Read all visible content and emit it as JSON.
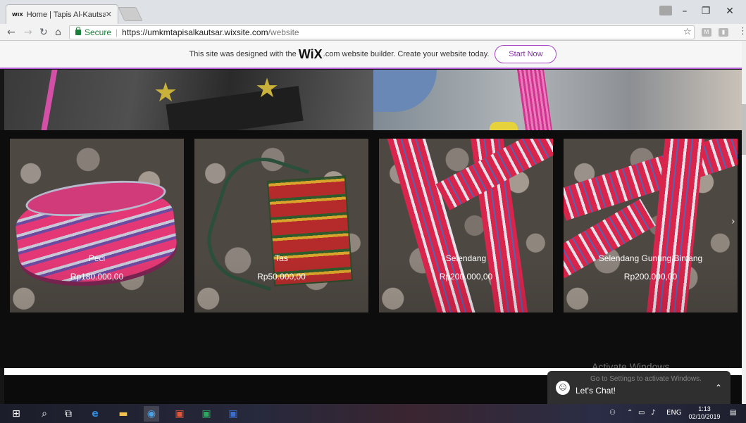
{
  "browser": {
    "tab_title": "Home | Tapis Al-Kautsar",
    "tab_favicon": "WIX",
    "secure_label": "Secure",
    "url_host": "https://umkmtapisalkautsar.wixsite.com",
    "url_path": "/website"
  },
  "wix_banner": {
    "text_before": "This site was designed with the",
    "logo": "WiX",
    "text_after": ".com website builder. Create your website today.",
    "button_label": "Start Now"
  },
  "products": [
    {
      "name": "Peci",
      "price": "Rp180.000,00"
    },
    {
      "name": "Tas",
      "price": "Rp50.000,00"
    },
    {
      "name": "Selendang",
      "price": "Rp200.000,00"
    },
    {
      "name": "Selendang Gunung Bintang",
      "price": "Rp200.000,00"
    }
  ],
  "watermark": {
    "title": "Activate Windows",
    "subtitle": "Go to Settings to activate Windows."
  },
  "chat": {
    "label": "Let's Chat!"
  },
  "taskbar": {
    "language": "ENG",
    "time": "1:13",
    "date": "02/10/2019"
  },
  "colors": {
    "wix_accent": "#a845c4",
    "secure_green": "#188038",
    "page_bg": "#0d0d0d"
  }
}
